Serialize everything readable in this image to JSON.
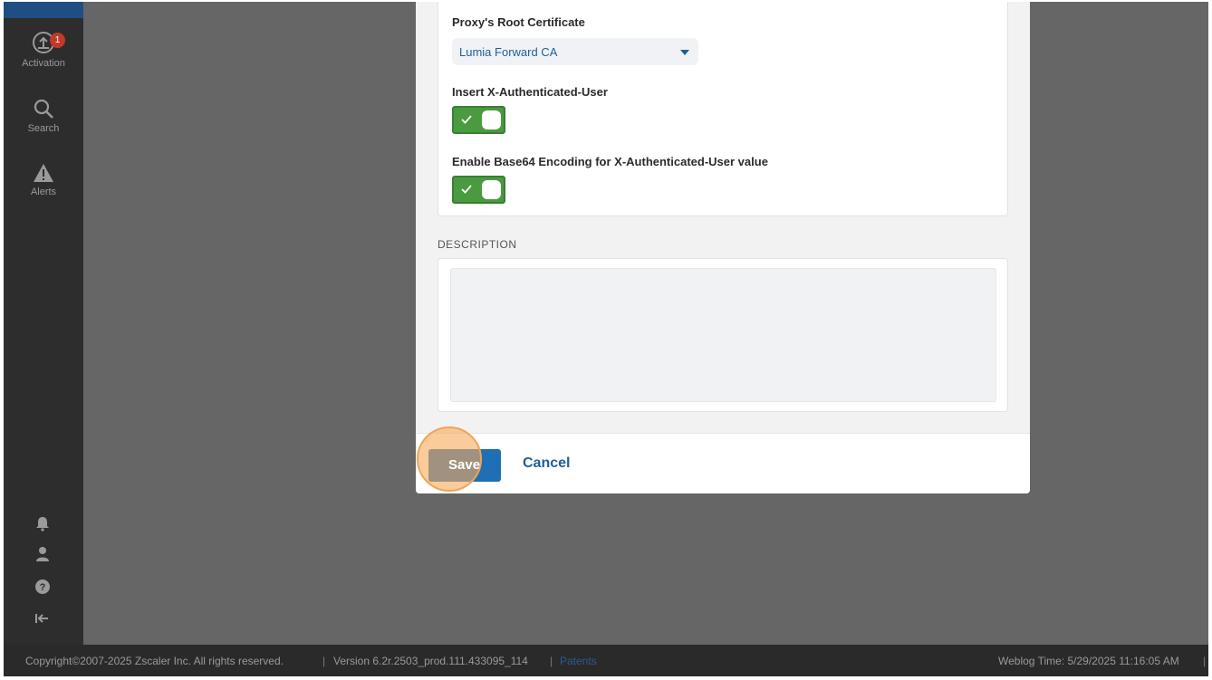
{
  "sidebar": {
    "activation_label": "Activation",
    "activation_badge": "1",
    "search_label": "Search",
    "alerts_label": "Alerts"
  },
  "dialog": {
    "root_cert_label": "Proxy's Root Certificate",
    "root_cert_value": "Lumia Forward CA",
    "insert_user_label": "Insert X-Authenticated-User",
    "insert_user_enabled": true,
    "base64_label": "Enable Base64 Encoding for X-Authenticated-User value",
    "base64_enabled": true,
    "description_section": "DESCRIPTION",
    "description_value": "",
    "save_label": "Save",
    "cancel_label": "Cancel"
  },
  "status_bar": {
    "copyright": "Copyright©2007-2025 Zscaler Inc. All rights reserved.",
    "version": "Version 6.2r.2503_prod.111.433095_114",
    "patents": "Patents",
    "weblog_time": "Weblog Time: 5/29/2025 11:16:05 AM"
  },
  "colors": {
    "accent": "#1f6fb5",
    "toggle_on": "#4a9a3f",
    "highlight": "#f2a356"
  }
}
